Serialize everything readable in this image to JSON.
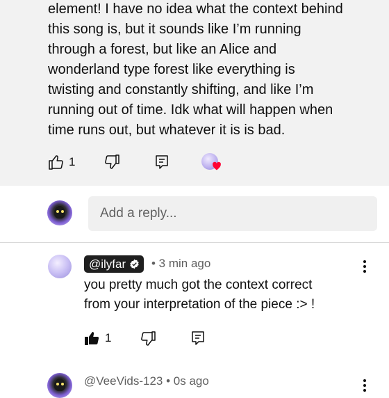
{
  "comment": {
    "lines": [
      "element! I have no idea what the context behind",
      "this song is, but it sounds like I’m running",
      "through a forest, but like an Alice and",
      "wonderland type forest like everything is",
      "twisting and constantly shifting, and like I’m",
      "running out of time. Idk what will happen when",
      "time runs out, but whatever it is is bad."
    ],
    "like_count": "1",
    "hearted": true
  },
  "reply_box": {
    "placeholder": "Add a reply..."
  },
  "replies": [
    {
      "handle": "@ilyfar",
      "verified_badge": true,
      "time": "• 3 min ago",
      "lines": [
        "you pretty much got the context correct",
        "from your interpretation of the piece :> !"
      ],
      "like_count": "1",
      "liked": true
    },
    {
      "handle": "@VeeVids-123",
      "time": "• 0s ago"
    }
  ],
  "icons": {
    "like": "thumbs-up-icon",
    "dislike": "thumbs-down-icon",
    "reply": "reply-comment-icon",
    "more": "more-vertical-icon",
    "heart": "heart-icon"
  },
  "colors": {
    "card_bg": "#f2f2f2",
    "heart": "#ff0033",
    "badge_bg": "#1f1f1f",
    "secondary_text": "#606060"
  }
}
